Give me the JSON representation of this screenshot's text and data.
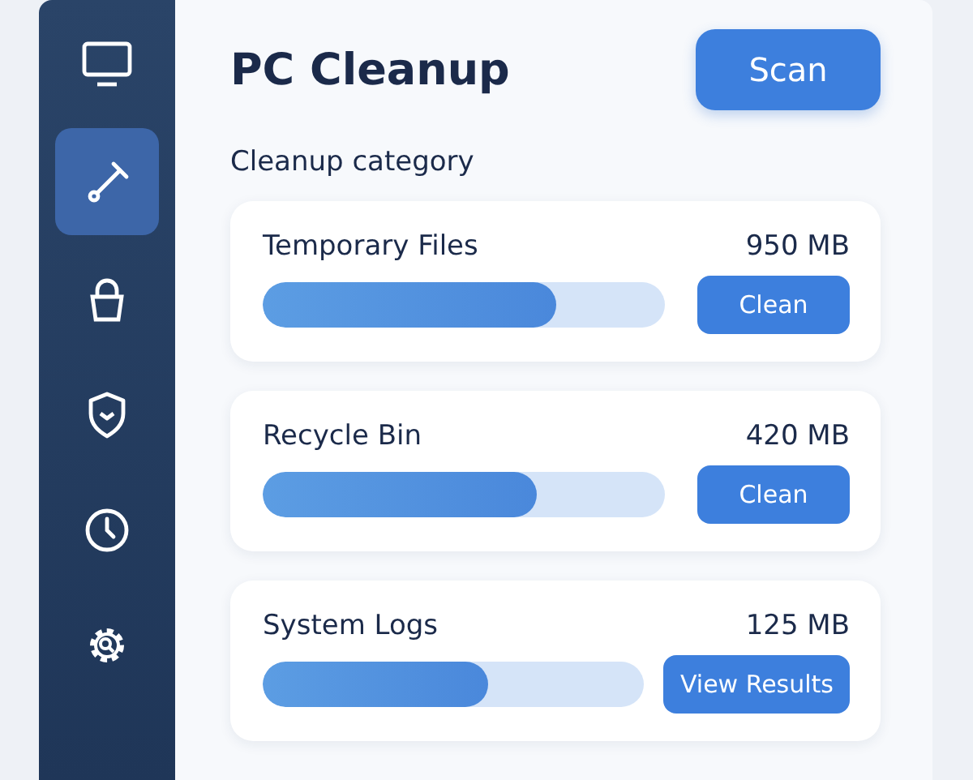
{
  "sidebar": {
    "items": [
      {
        "kind": "monitor",
        "selected": false
      },
      {
        "kind": "broom",
        "selected": true
      },
      {
        "kind": "lock",
        "selected": false
      },
      {
        "kind": "shield",
        "selected": false
      },
      {
        "kind": "clock",
        "selected": false
      },
      {
        "kind": "gear",
        "selected": false
      }
    ]
  },
  "title": "PC Cleanup",
  "scan_button": "Scan",
  "section_label": "Cleanup category",
  "categories": [
    {
      "name": "Temporary Files",
      "size": "950 MB",
      "level": 0.73,
      "action": "Clean"
    },
    {
      "name": "Recycle Bin",
      "size": "420 MB",
      "level": 0.68,
      "action": "Clean"
    },
    {
      "name": "System Logs",
      "size": "125 MB",
      "level": 0.59,
      "action": "View Results"
    }
  ]
}
